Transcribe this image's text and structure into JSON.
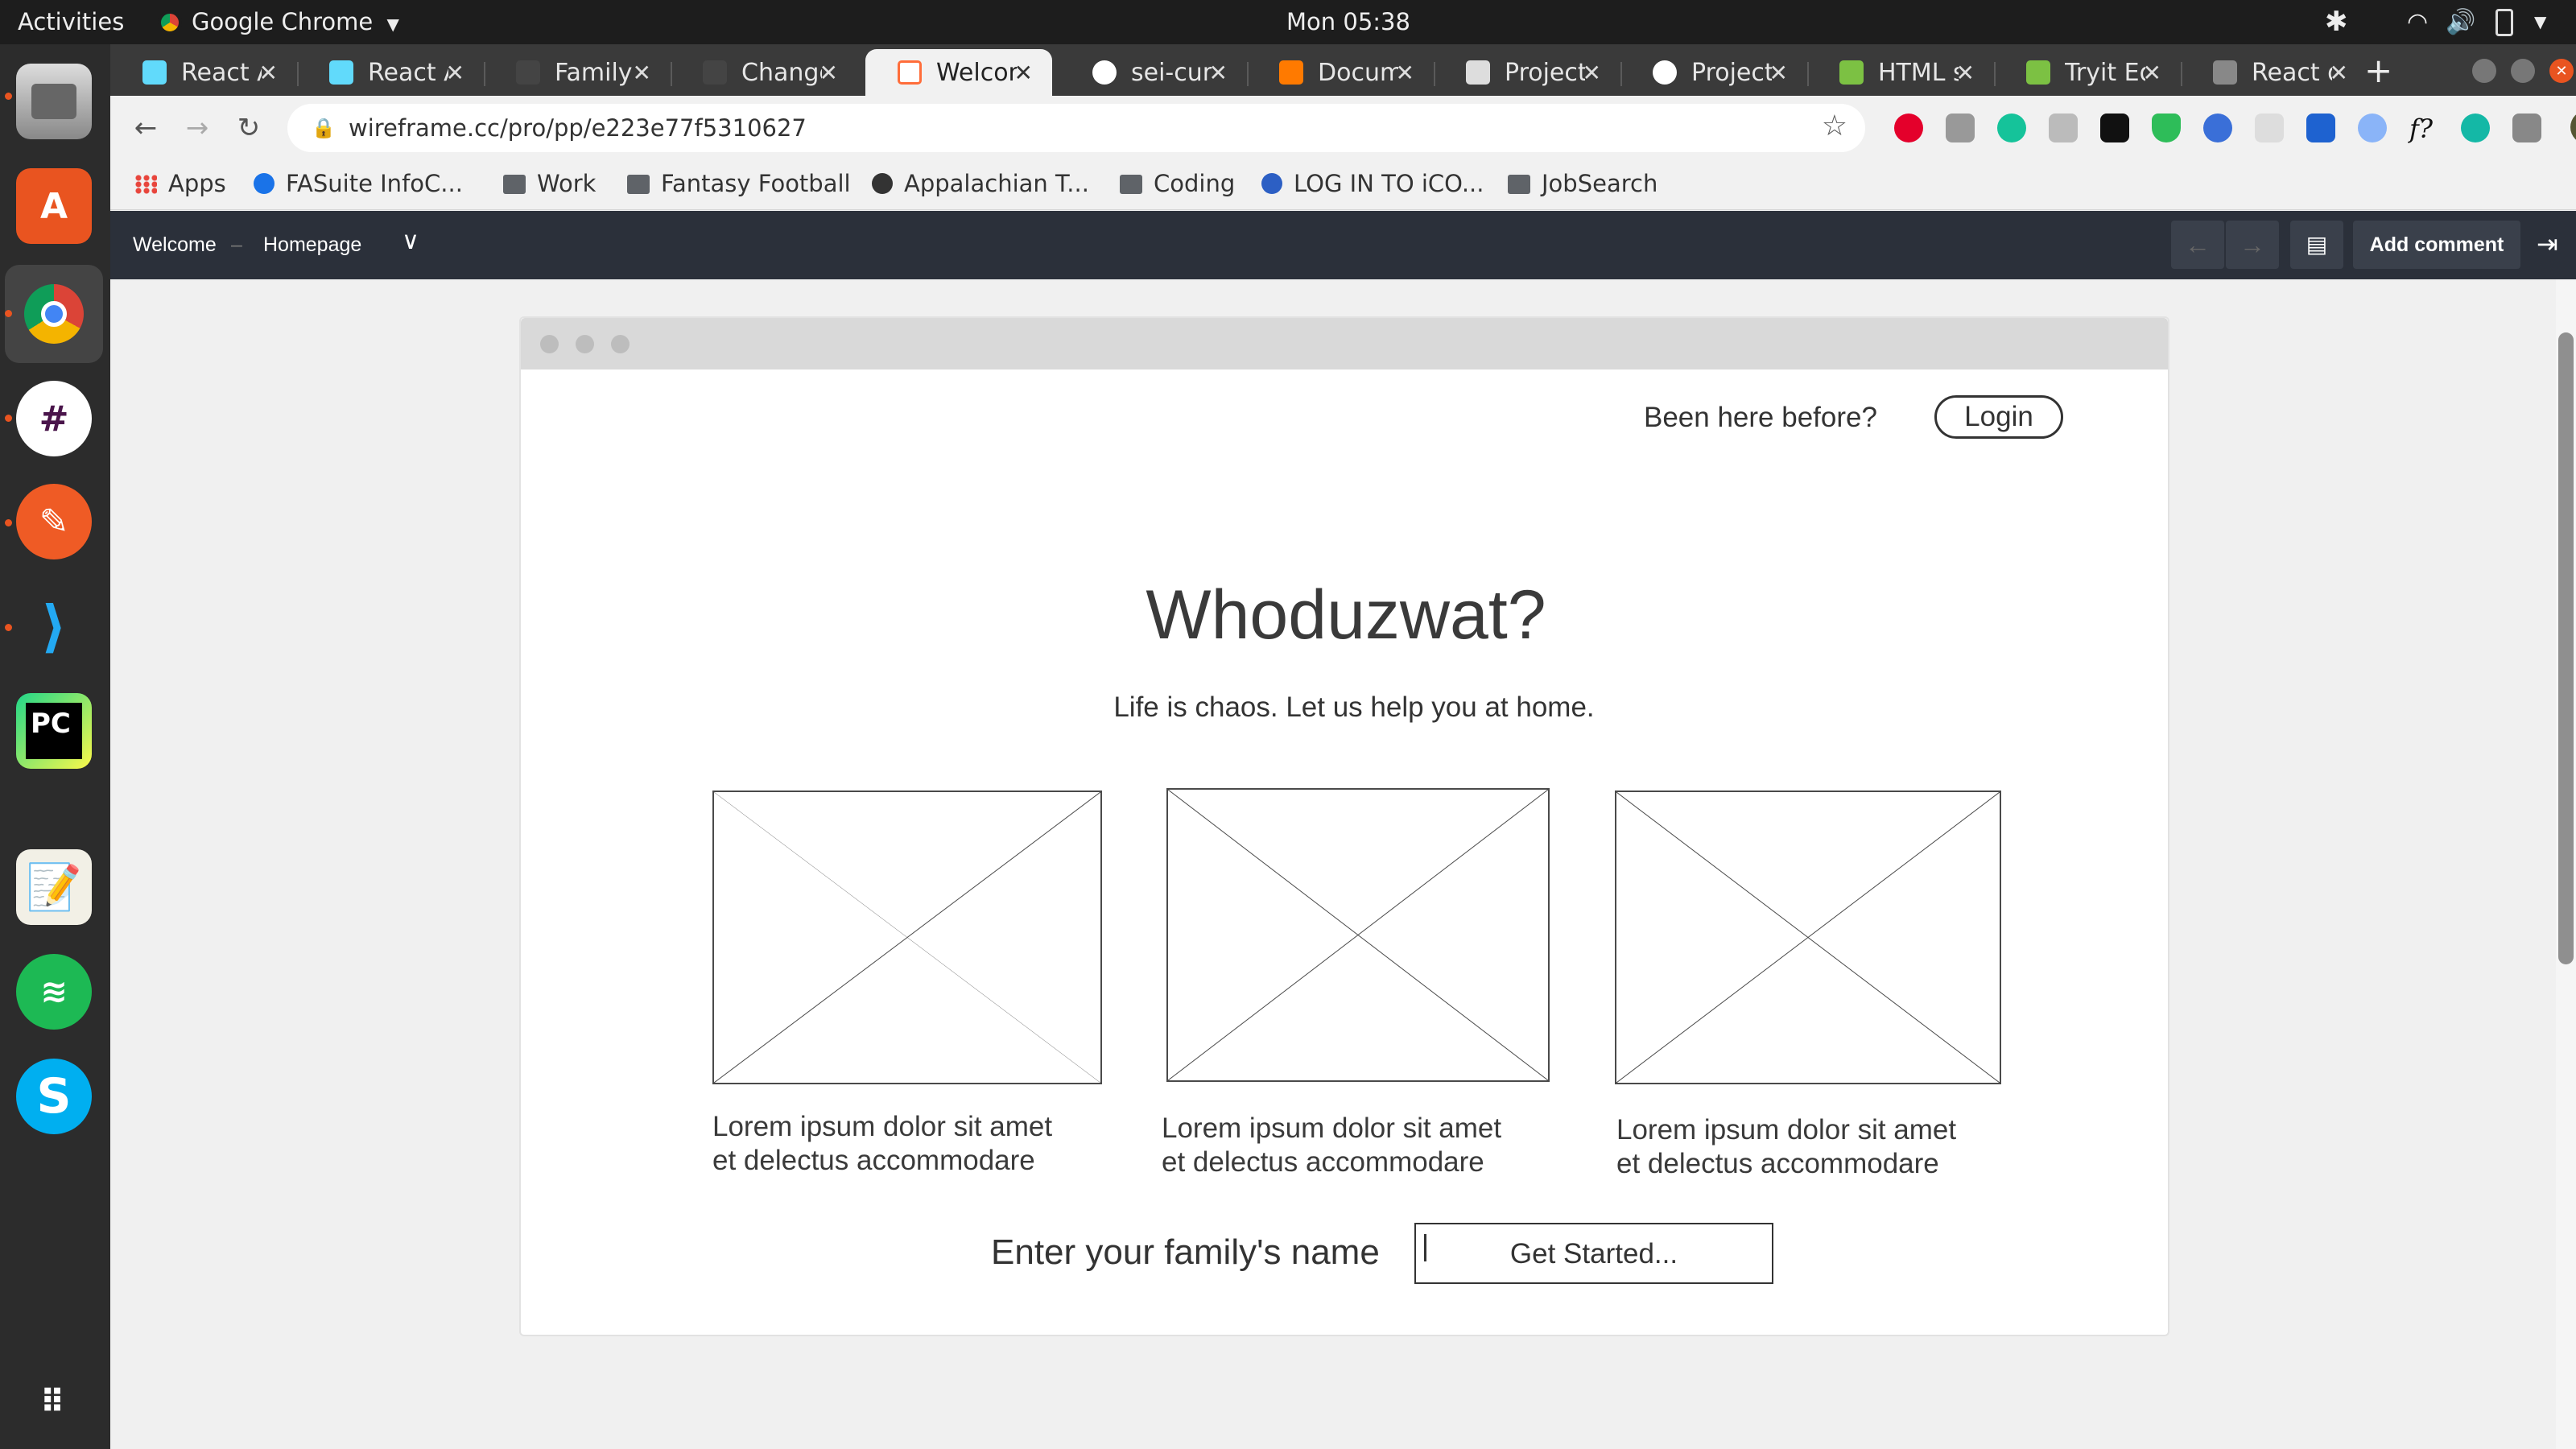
{
  "topbar": {
    "activities": "Activities",
    "app_name": "Google Chrome",
    "clock": "Mon 05:38"
  },
  "tabs": [
    {
      "label": "React A",
      "color": "#61dafb"
    },
    {
      "label": "React A",
      "color": "#61dafb"
    },
    {
      "label": "Family /",
      "color": "#444444"
    },
    {
      "label": "Change",
      "color": "#444444"
    },
    {
      "label": "Welcom",
      "color": "#ff6d3a"
    },
    {
      "label": "sei-curr",
      "color": "#ffffff"
    },
    {
      "label": "Docum",
      "color": "#ff7a00"
    },
    {
      "label": "Project",
      "color": "#dddddd"
    },
    {
      "label": "Project",
      "color": "#ffffff"
    },
    {
      "label": "HTML s",
      "color": "#7cc143"
    },
    {
      "label": "Tryit Ed",
      "color": "#7cc143"
    },
    {
      "label": "React d",
      "color": "#888888"
    }
  ],
  "toolbar": {
    "url": "wireframe.cc/pro/pp/e223e77f5310627"
  },
  "bookmarks": [
    {
      "label": "Apps",
      "icon": "apps-grid"
    },
    {
      "label": "FASuite InfoC...",
      "icon": "globe"
    },
    {
      "label": "Work",
      "icon": "folder"
    },
    {
      "label": "Fantasy Football",
      "icon": "folder"
    },
    {
      "label": "Appalachian T...",
      "icon": "globe"
    },
    {
      "label": "Coding",
      "icon": "folder"
    },
    {
      "label": "LOG IN TO iCO...",
      "icon": "link"
    },
    {
      "label": "JobSearch",
      "icon": "folder"
    }
  ],
  "wireframe_bar": {
    "breadcrumb_first": "Welcome",
    "separator": "–",
    "breadcrumb_second": "Homepage",
    "add_comment": "Add comment"
  },
  "page": {
    "been_here": "Been here before?",
    "login": "Login",
    "title": "Whoduzwat?",
    "subtitle": "Life is chaos. Let us help you at home.",
    "cards": [
      {
        "line1": "Lorem ipsum dolor sit amet",
        "line2": "et delectus accommodare"
      },
      {
        "line1": "Lorem ipsum dolor sit amet",
        "line2": "et delectus accommodare"
      },
      {
        "line1": "Lorem ipsum dolor sit amet",
        "line2": "et delectus accommodare"
      }
    ],
    "family_label": "Enter your family's name",
    "family_placeholder": "Get Started..."
  }
}
